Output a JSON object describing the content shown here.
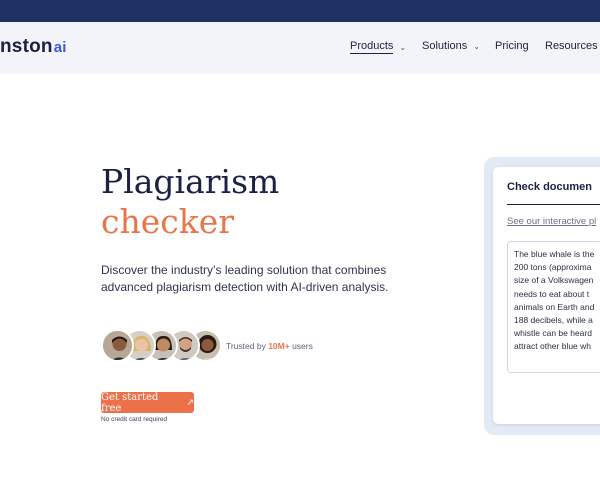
{
  "header": {
    "logo_text": "nston",
    "logo_suffix": "ai",
    "nav": [
      {
        "label": "Products",
        "has_dropdown": true,
        "active": true
      },
      {
        "label": "Solutions",
        "has_dropdown": true,
        "active": false
      },
      {
        "label": "Pricing",
        "has_dropdown": false,
        "active": false
      },
      {
        "label": "Resources",
        "has_dropdown": false,
        "active": false
      }
    ]
  },
  "hero": {
    "title_line1": "Plagiarism",
    "title_line2": "checker",
    "description": "Discover the industry’s leading solution that combines advanced plagiarism detection with AI-driven analysis.",
    "trusted_prefix": "Trusted by ",
    "trusted_highlight": "10M+",
    "trusted_suffix": " users",
    "cta_label": "Get started free",
    "cta_arrow": "↗",
    "no_cc": "No credit card required"
  },
  "check_card": {
    "title": "Check documen",
    "link": "See our interactive pl",
    "sample_lines": [
      "The blue whale is the",
      "200 tons (approxima",
      "size of a Volkswagen",
      "needs to eat about t",
      "animals on Earth and",
      "188 decibels, while a",
      "whistle can be heard",
      "attract other blue wh"
    ]
  },
  "colors": {
    "top_bar": "#1f3264",
    "nav_bg": "#f3f4f9",
    "accent_orange": "#ec7048",
    "text_dark": "#1a2142",
    "brand_blue": "#3e57d6"
  }
}
